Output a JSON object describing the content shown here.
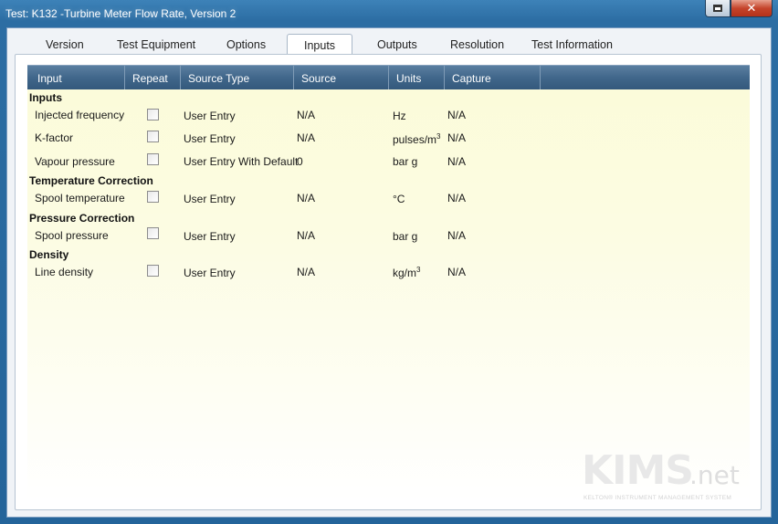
{
  "window": {
    "title": "Test: K132 -Turbine Meter Flow Rate, Version 2"
  },
  "tabs": [
    {
      "label": "Version"
    },
    {
      "label": "Test Equipment"
    },
    {
      "label": "Options"
    },
    {
      "label": "Inputs",
      "active": true
    },
    {
      "label": "Outputs"
    },
    {
      "label": "Resolution"
    },
    {
      "label": "Test Information"
    }
  ],
  "grid": {
    "columns": [
      "Input",
      "Repeat",
      "Source Type",
      "Source",
      "Units",
      "Capture"
    ],
    "groups": [
      {
        "name": "Inputs",
        "rows": [
          {
            "input": "Injected frequency",
            "repeat": false,
            "source_type": "User Entry",
            "source": "N/A",
            "units": "Hz",
            "capture": "N/A"
          },
          {
            "input": "K-factor",
            "repeat": false,
            "source_type": "User Entry",
            "source": "N/A",
            "units": "pulses/m",
            "units_sup": "3",
            "capture": "N/A"
          },
          {
            "input": "Vapour pressure",
            "repeat": false,
            "source_type": "User Entry With Default",
            "source": "0",
            "units": "bar g",
            "capture": "N/A"
          }
        ]
      },
      {
        "name": "Temperature Correction",
        "rows": [
          {
            "input": "Spool temperature",
            "repeat": false,
            "source_type": "User Entry",
            "source": "N/A",
            "units": "°C",
            "capture": "N/A"
          }
        ]
      },
      {
        "name": "Pressure Correction",
        "rows": [
          {
            "input": "Spool pressure",
            "repeat": false,
            "source_type": "User Entry",
            "source": "N/A",
            "units": "bar g",
            "capture": "N/A"
          }
        ]
      },
      {
        "name": "Density",
        "rows": [
          {
            "input": "Line density",
            "repeat": false,
            "source_type": "User Entry",
            "source": "N/A",
            "units": "kg/m",
            "units_sup": "3",
            "capture": "N/A"
          }
        ]
      }
    ]
  },
  "logo": {
    "main": "KIMS",
    "suffix": ".net",
    "tagline": "KELTON® INSTRUMENT MANAGEMENT SYSTEM"
  },
  "colors": {
    "header_bg": "#3f6589",
    "grid_bg": "#fbfbd8",
    "titlebar": "#2c6da3"
  }
}
